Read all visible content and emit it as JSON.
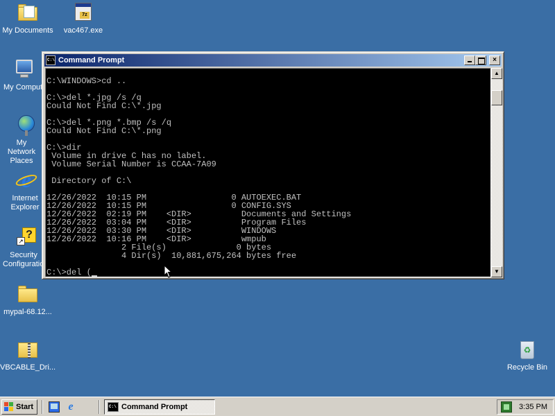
{
  "desktop": {
    "icons": [
      {
        "label": "My Documents"
      },
      {
        "label": "vac467.exe"
      },
      {
        "label": "My Computer"
      },
      {
        "label": "My Network Places"
      },
      {
        "label": "Internet Explorer"
      },
      {
        "label": "Security Configuration"
      },
      {
        "label": "mypal-68.12..."
      },
      {
        "label": "VBCABLE_Dri..."
      },
      {
        "label": "Recycle Bin"
      }
    ]
  },
  "window": {
    "title": "Command Prompt",
    "buttons": {
      "minimize": "",
      "maximize": "",
      "close": "×"
    },
    "scrollbar": {
      "up": "▲",
      "down": "▼"
    },
    "console_lines": [
      "C:\\WINDOWS>cd ..",
      "",
      "C:\\>del *.jpg /s /q",
      "Could Not Find C:\\*.jpg",
      "",
      "C:\\>del *.png *.bmp /s /q",
      "Could Not Find C:\\*.png",
      "",
      "C:\\>dir",
      " Volume in drive C has no label.",
      " Volume Serial Number is CCAA-7A09",
      "",
      " Directory of C:\\",
      "",
      "12/26/2022  10:15 PM                 0 AUTOEXEC.BAT",
      "12/26/2022  10:15 PM                 0 CONFIG.SYS",
      "12/26/2022  02:19 PM    <DIR>          Documents and Settings",
      "12/26/2022  03:04 PM    <DIR>          Program Files",
      "12/26/2022  03:30 PM    <DIR>          WINDOWS",
      "12/26/2022  10:16 PM    <DIR>          wmpub",
      "               2 File(s)              0 bytes",
      "               4 Dir(s)  10,881,675,264 bytes free",
      ""
    ],
    "prompt_line": "C:\\>del (",
    "title_icon_text": "C:\\"
  },
  "taskbar": {
    "start_label": "Start",
    "task_button_label": "Command Prompt",
    "task_icon_text": "C:\\",
    "clock": "3:35 PM"
  }
}
